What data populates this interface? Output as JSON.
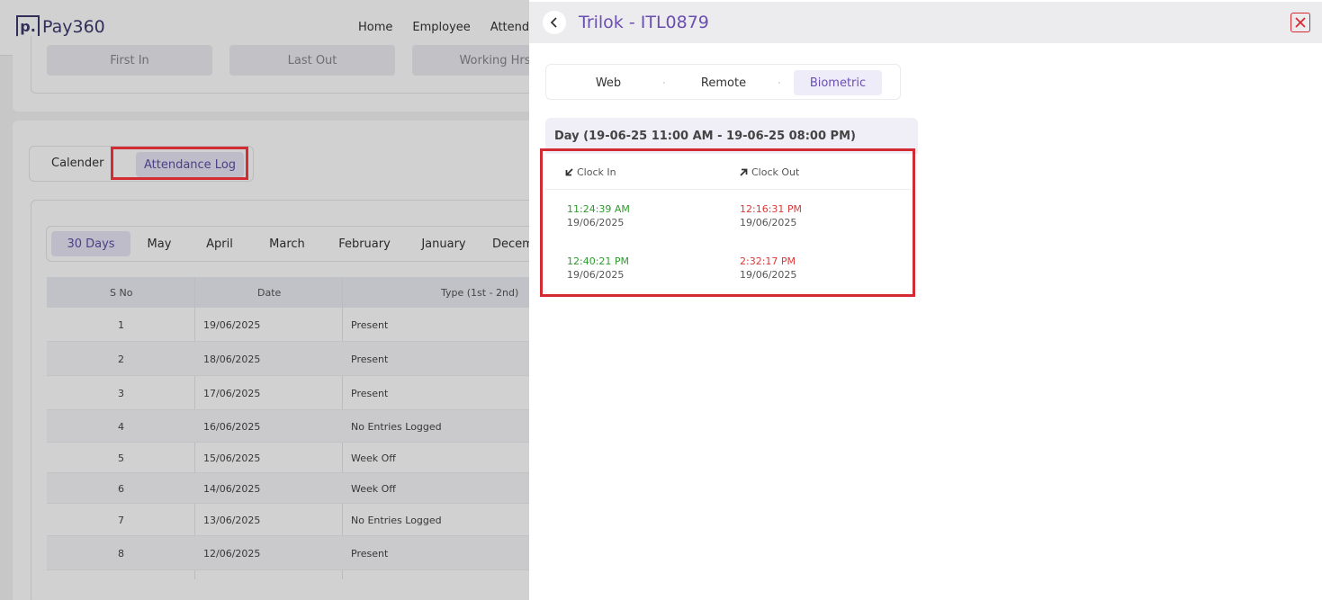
{
  "app": {
    "logo_letter": "p.",
    "logo_name": "Pay360",
    "nav": [
      "Home",
      "Employee",
      "Attenda"
    ],
    "stats": [
      "First In",
      "Last Out",
      "Working Hrs"
    ],
    "view_toggle": {
      "calendar": "Calender",
      "log": "Attendance Log"
    },
    "months": [
      "30 Days",
      "May",
      "April",
      "March",
      "February",
      "January",
      "Decem"
    ],
    "table": {
      "headers": [
        "S No",
        "Date",
        "Type (1st - 2nd)"
      ],
      "rows": [
        {
          "sno": "1",
          "date": "19/06/2025",
          "type": "Present"
        },
        {
          "sno": "2",
          "date": "18/06/2025",
          "type": "Present"
        },
        {
          "sno": "3",
          "date": "17/06/2025",
          "type": "Present"
        },
        {
          "sno": "4",
          "date": "16/06/2025",
          "type": "No Entries Logged"
        },
        {
          "sno": "5",
          "date": "15/06/2025",
          "type": "Week Off"
        },
        {
          "sno": "6",
          "date": "14/06/2025",
          "type": "Week Off"
        },
        {
          "sno": "7",
          "date": "13/06/2025",
          "type": "No Entries Logged"
        },
        {
          "sno": "8",
          "date": "12/06/2025",
          "type": "Present"
        }
      ]
    }
  },
  "panel": {
    "title": "Trilok - ITL0879",
    "tabs": [
      "Web",
      "Remote",
      "Biometric"
    ],
    "active_tab": "Biometric",
    "day_label": "Day (19-06-25 11:00 AM - 19-06-25 08:00 PM)",
    "clock_in_label": "Clock In",
    "clock_out_label": "Clock Out",
    "entries": [
      {
        "in_time": "11:24:39 AM",
        "in_date": "19/06/2025",
        "out_time": "12:16:31 PM",
        "out_date": "19/06/2025"
      },
      {
        "in_time": "12:40:21 PM",
        "in_date": "19/06/2025",
        "out_time": "2:32:17 PM",
        "out_date": "19/06/2025"
      }
    ]
  },
  "colors": {
    "accent": "#6a4fb0",
    "clock_in": "#2e9a2e",
    "clock_out": "#d93a3a",
    "highlight": "#d42b33"
  },
  "icons": [
    "back-chevron-icon",
    "close-icon",
    "clock-in-arrow-icon",
    "clock-out-arrow-icon"
  ]
}
